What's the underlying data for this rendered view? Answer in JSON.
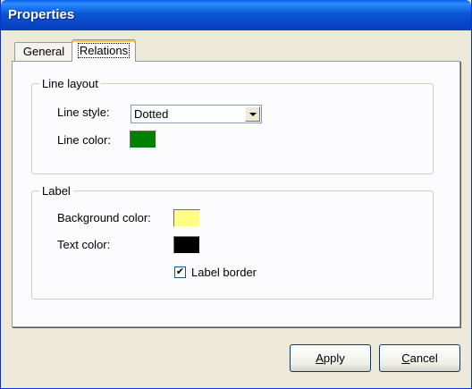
{
  "window": {
    "title": "Properties"
  },
  "tabs": [
    {
      "label": "General",
      "selected": false
    },
    {
      "label": "Relations",
      "selected": true
    }
  ],
  "line_layout": {
    "legend": "Line layout",
    "line_style_label": "Line style:",
    "line_style_value": "Dotted",
    "line_color_label": "Line color:",
    "line_color": "#008000"
  },
  "label": {
    "legend": "Label",
    "background_color_label": "Background color:",
    "background_color": "#ffff80",
    "text_color_label": "Text color:",
    "text_color": "#000000",
    "label_border_text": "Label border",
    "label_border_checked": true
  },
  "buttons": {
    "apply_first": "A",
    "apply_rest": "pply",
    "cancel_first": "C",
    "cancel_rest": "ancel"
  }
}
